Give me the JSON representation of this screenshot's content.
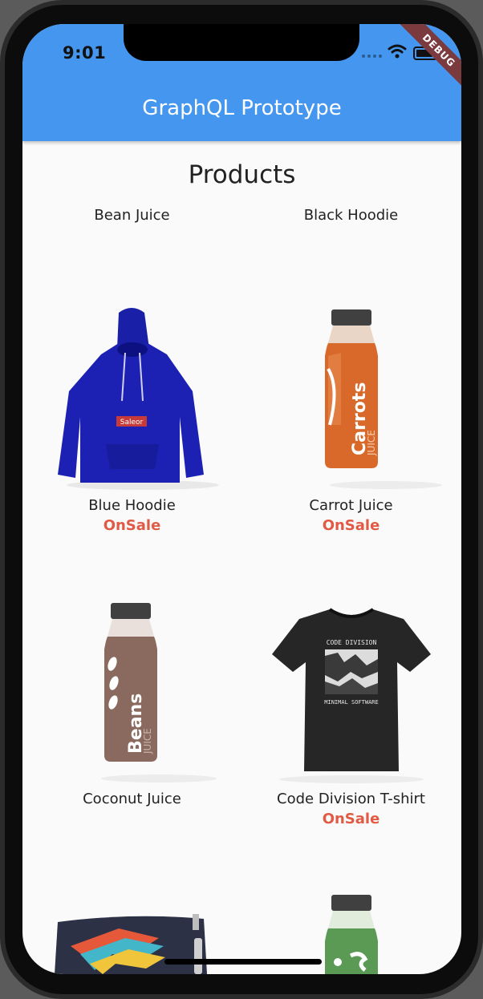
{
  "status_bar": {
    "time": "9:01",
    "debug_label": "DEBUG"
  },
  "app_bar": {
    "title": "GraphQL Prototype"
  },
  "page": {
    "title": "Products"
  },
  "products": [
    {
      "name": "Bean Juice",
      "badge": ""
    },
    {
      "name": "Black Hoodie",
      "badge": ""
    },
    {
      "name": "Blue Hoodie",
      "badge": "OnSale",
      "hoodie_label": "Saleor"
    },
    {
      "name": "Carrot Juice",
      "badge": "OnSale",
      "bottle_brand": "Carrots",
      "bottle_type": "JUICE"
    },
    {
      "name": "Coconut Juice",
      "badge": "",
      "bottle_brand": "Beans",
      "bottle_type": "JUICE"
    },
    {
      "name": "Code Division T-shirt",
      "badge": "OnSale",
      "shirt_top": "CODE DIVISION",
      "shirt_bottom": "MINIMAL SOFTWARE"
    }
  ],
  "colors": {
    "app_bar": "#4496ee",
    "sale": "#e05a45",
    "carrot_bottle": "#d9692b",
    "bean_bottle": "#8a6a5e",
    "green_bottle": "#5a9a55",
    "hoodie": "#1c21b4",
    "tshirt": "#262626"
  }
}
